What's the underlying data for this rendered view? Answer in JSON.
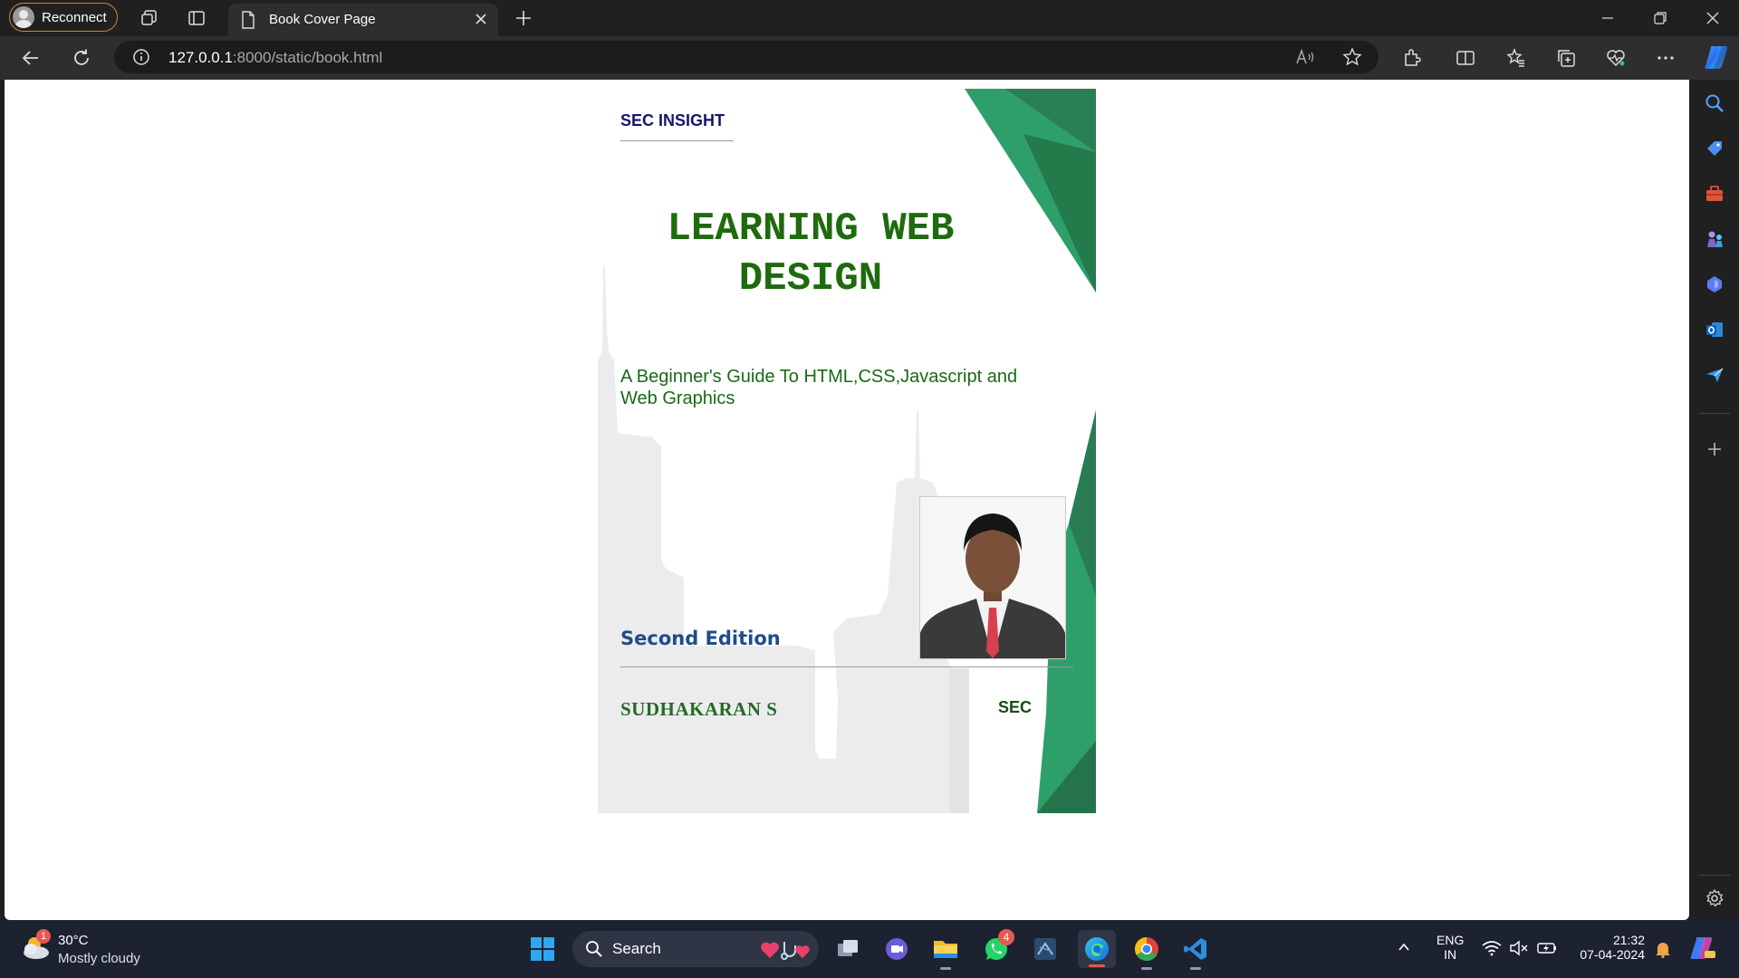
{
  "browser": {
    "profile_label": "Reconnect",
    "tab_title": "Book Cover Page",
    "url_host": "127.0.0.1",
    "url_rest": ":8000/static/book.html"
  },
  "book": {
    "publisher": "SEC INSIGHT",
    "title_line1": "LEARNING WEB",
    "title_line2": "DESIGN",
    "subtitle": "A Beginner's Guide To HTML,CSS,Javascript and Web Graphics",
    "edition": "Second Edition",
    "author": "SUDHAKARAN S",
    "imprint": "SEC",
    "colors": {
      "title": "#1e6b0e",
      "accent_green": "#2e9e6a",
      "dark_green": "#237a4a",
      "skyline": "#ececec"
    }
  },
  "taskbar": {
    "weather_badge": "1",
    "weather_temp": "30°C",
    "weather_desc": "Mostly cloudy",
    "search_label": "Search",
    "whatsapp_badge": "4",
    "lang_line1": "ENG",
    "lang_line2": "IN",
    "time": "21:32",
    "date": "07-04-2024"
  }
}
